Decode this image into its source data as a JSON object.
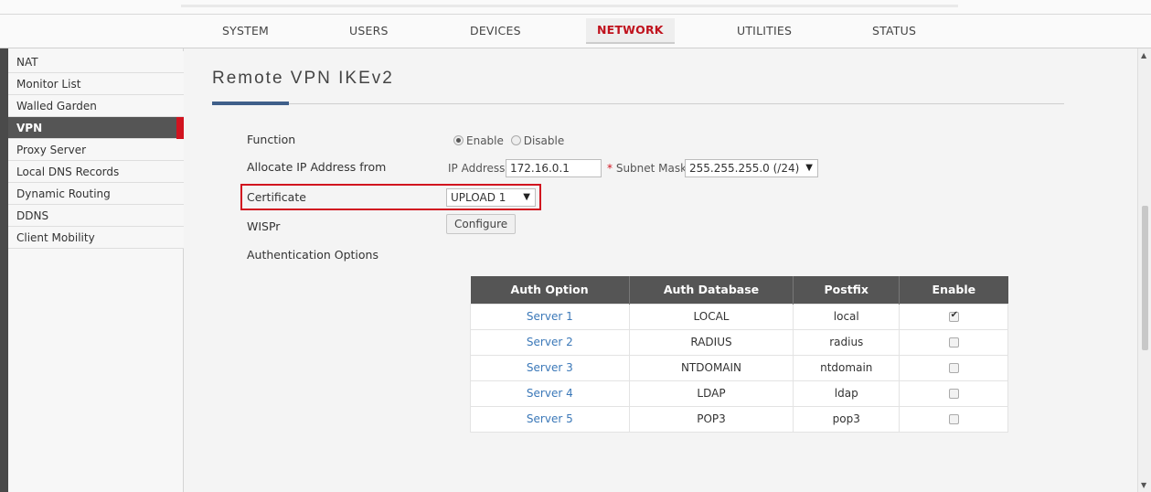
{
  "nav": {
    "items": [
      "SYSTEM",
      "USERS",
      "DEVICES",
      "NETWORK",
      "UTILITIES",
      "STATUS"
    ],
    "active": "NETWORK"
  },
  "sidebar": {
    "items": [
      "NAT",
      "Monitor List",
      "Walled Garden",
      "VPN",
      "Proxy Server",
      "Local DNS Records",
      "Dynamic Routing",
      "DDNS",
      "Client Mobility"
    ],
    "active": "VPN"
  },
  "page": {
    "title": "Remote VPN  IKEv2"
  },
  "form": {
    "function_label": "Function",
    "enable_label": "Enable",
    "disable_label": "Disable",
    "function_value": "Enable",
    "allocate_label": "Allocate IP Address from",
    "ip_address_label": "IP Address",
    "ip_address_value": "172.16.0.1",
    "required_mark": "*",
    "subnet_mask_label": "Subnet Mask",
    "subnet_mask_value": "255.255.255.0 (/24)",
    "certificate_label": "Certificate",
    "certificate_value": "UPLOAD 1",
    "wispr_label": "WISPr",
    "configure_button": "Configure",
    "auth_options_label": "Authentication Options"
  },
  "auth_table": {
    "headers": [
      "Auth Option",
      "Auth Database",
      "Postfix",
      "Enable"
    ],
    "rows": [
      {
        "option": "Server 1",
        "database": "LOCAL",
        "postfix": "local",
        "enabled": true
      },
      {
        "option": "Server 2",
        "database": "RADIUS",
        "postfix": "radius",
        "enabled": false
      },
      {
        "option": "Server 3",
        "database": "NTDOMAIN",
        "postfix": "ntdomain",
        "enabled": false
      },
      {
        "option": "Server 4",
        "database": "LDAP",
        "postfix": "ldap",
        "enabled": false
      },
      {
        "option": "Server 5",
        "database": "POP3",
        "postfix": "pop3",
        "enabled": false
      }
    ]
  },
  "colors": {
    "accent_red": "#d1131f",
    "sidebar_active": "#555555",
    "link_blue": "#3b78b8",
    "title_accent": "#3f5f8a"
  },
  "icons": {
    "dropdown": "chevron-down-icon",
    "checkbox_checked": "check-icon",
    "scroll_up": "arrow-up-icon",
    "scroll_down": "arrow-down-icon"
  }
}
